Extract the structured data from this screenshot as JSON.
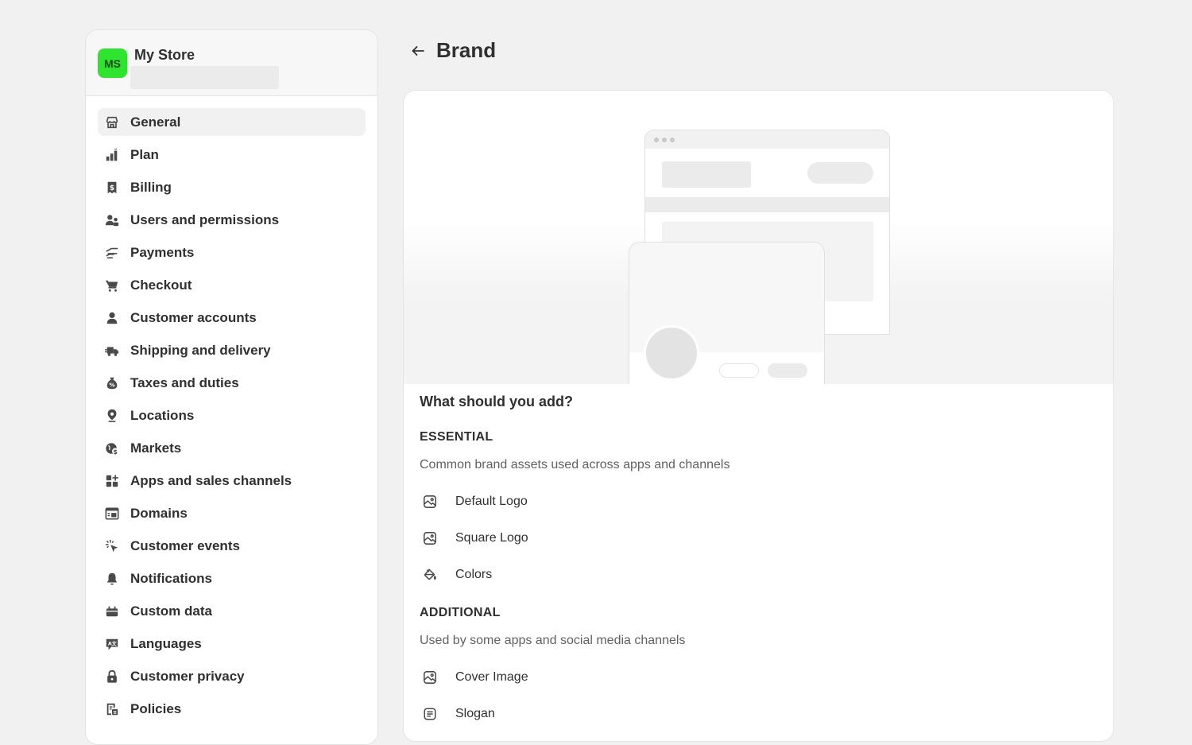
{
  "store": {
    "initials": "MS",
    "name": "My Store",
    "avatar_color": "#2ee42e"
  },
  "nav": {
    "items": [
      {
        "label": "General",
        "icon": "store-icon",
        "active": true
      },
      {
        "label": "Plan",
        "icon": "chart-bars-icon"
      },
      {
        "label": "Billing",
        "icon": "receipt-dollar-icon"
      },
      {
        "label": "Users and permissions",
        "icon": "users-icon"
      },
      {
        "label": "Payments",
        "icon": "hand-card-icon"
      },
      {
        "label": "Checkout",
        "icon": "cart-icon"
      },
      {
        "label": "Customer accounts",
        "icon": "person-icon"
      },
      {
        "label": "Shipping and delivery",
        "icon": "truck-icon"
      },
      {
        "label": "Taxes and duties",
        "icon": "money-bag-icon"
      },
      {
        "label": "Locations",
        "icon": "location-pin-icon"
      },
      {
        "label": "Markets",
        "icon": "globe-dollar-icon"
      },
      {
        "label": "Apps and sales channels",
        "icon": "apps-add-icon"
      },
      {
        "label": "Domains",
        "icon": "domain-icon"
      },
      {
        "label": "Customer events",
        "icon": "cursor-click-icon"
      },
      {
        "label": "Notifications",
        "icon": "bell-icon"
      },
      {
        "label": "Custom data",
        "icon": "database-icon"
      },
      {
        "label": "Languages",
        "icon": "translate-icon"
      },
      {
        "label": "Customer privacy",
        "icon": "lock-icon"
      },
      {
        "label": "Policies",
        "icon": "policy-icon"
      }
    ]
  },
  "page": {
    "title": "Brand"
  },
  "content": {
    "question": "What should you add?",
    "essential": {
      "heading": "ESSENTIAL",
      "description": "Common brand assets used across apps and channels",
      "items": [
        {
          "label": "Default Logo",
          "icon": "image-icon"
        },
        {
          "label": "Square Logo",
          "icon": "image-icon"
        },
        {
          "label": "Colors",
          "icon": "paint-bucket-icon"
        }
      ]
    },
    "additional": {
      "heading": "ADDITIONAL",
      "description": "Used by some apps and social media channels",
      "items": [
        {
          "label": "Cover Image",
          "icon": "image-icon"
        },
        {
          "label": "Slogan",
          "icon": "text-block-icon"
        }
      ]
    }
  }
}
